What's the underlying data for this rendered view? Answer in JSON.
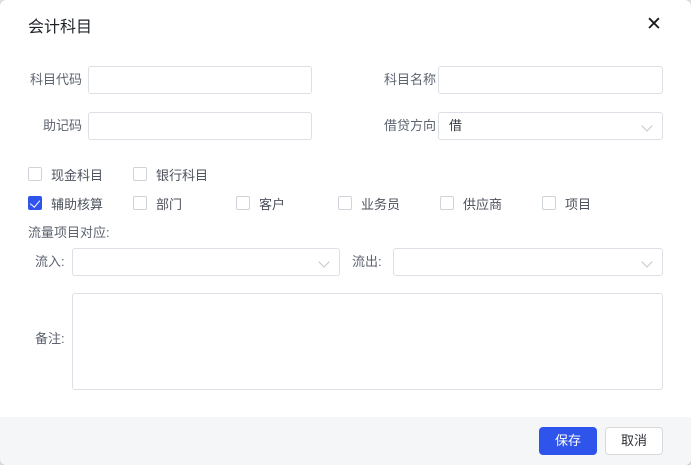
{
  "dialog": {
    "title": "会计科目"
  },
  "icons": {
    "close_glyph": "✕"
  },
  "fields": {
    "code": {
      "label": "科目代码",
      "value": ""
    },
    "name": {
      "label": "科目名称",
      "value": ""
    },
    "mnemonic": {
      "label": "助记码",
      "value": ""
    },
    "direction": {
      "label": "借贷方向",
      "value": "借"
    }
  },
  "checkbox_rows": {
    "row1": [
      {
        "label": "现金科目",
        "checked": false
      },
      {
        "label": "银行科目",
        "checked": false
      }
    ],
    "row2": [
      {
        "label": "辅助核算",
        "checked": true
      },
      {
        "label": "部门",
        "checked": false
      },
      {
        "label": "客户",
        "checked": false
      },
      {
        "label": "业务员",
        "checked": false
      },
      {
        "label": "供应商",
        "checked": false
      },
      {
        "label": "项目",
        "checked": false
      }
    ]
  },
  "flow": {
    "heading": "流量项目对应:",
    "inflow": {
      "label": "流入:",
      "value": ""
    },
    "outflow": {
      "label": "流出:",
      "value": ""
    }
  },
  "remark": {
    "label": "备注:",
    "value": ""
  },
  "footer": {
    "save": "保存",
    "cancel": "取消"
  },
  "colors": {
    "primary": "#2f54eb",
    "footer_bg": "#f5f6f8",
    "input_border": "#dcdfe6"
  }
}
